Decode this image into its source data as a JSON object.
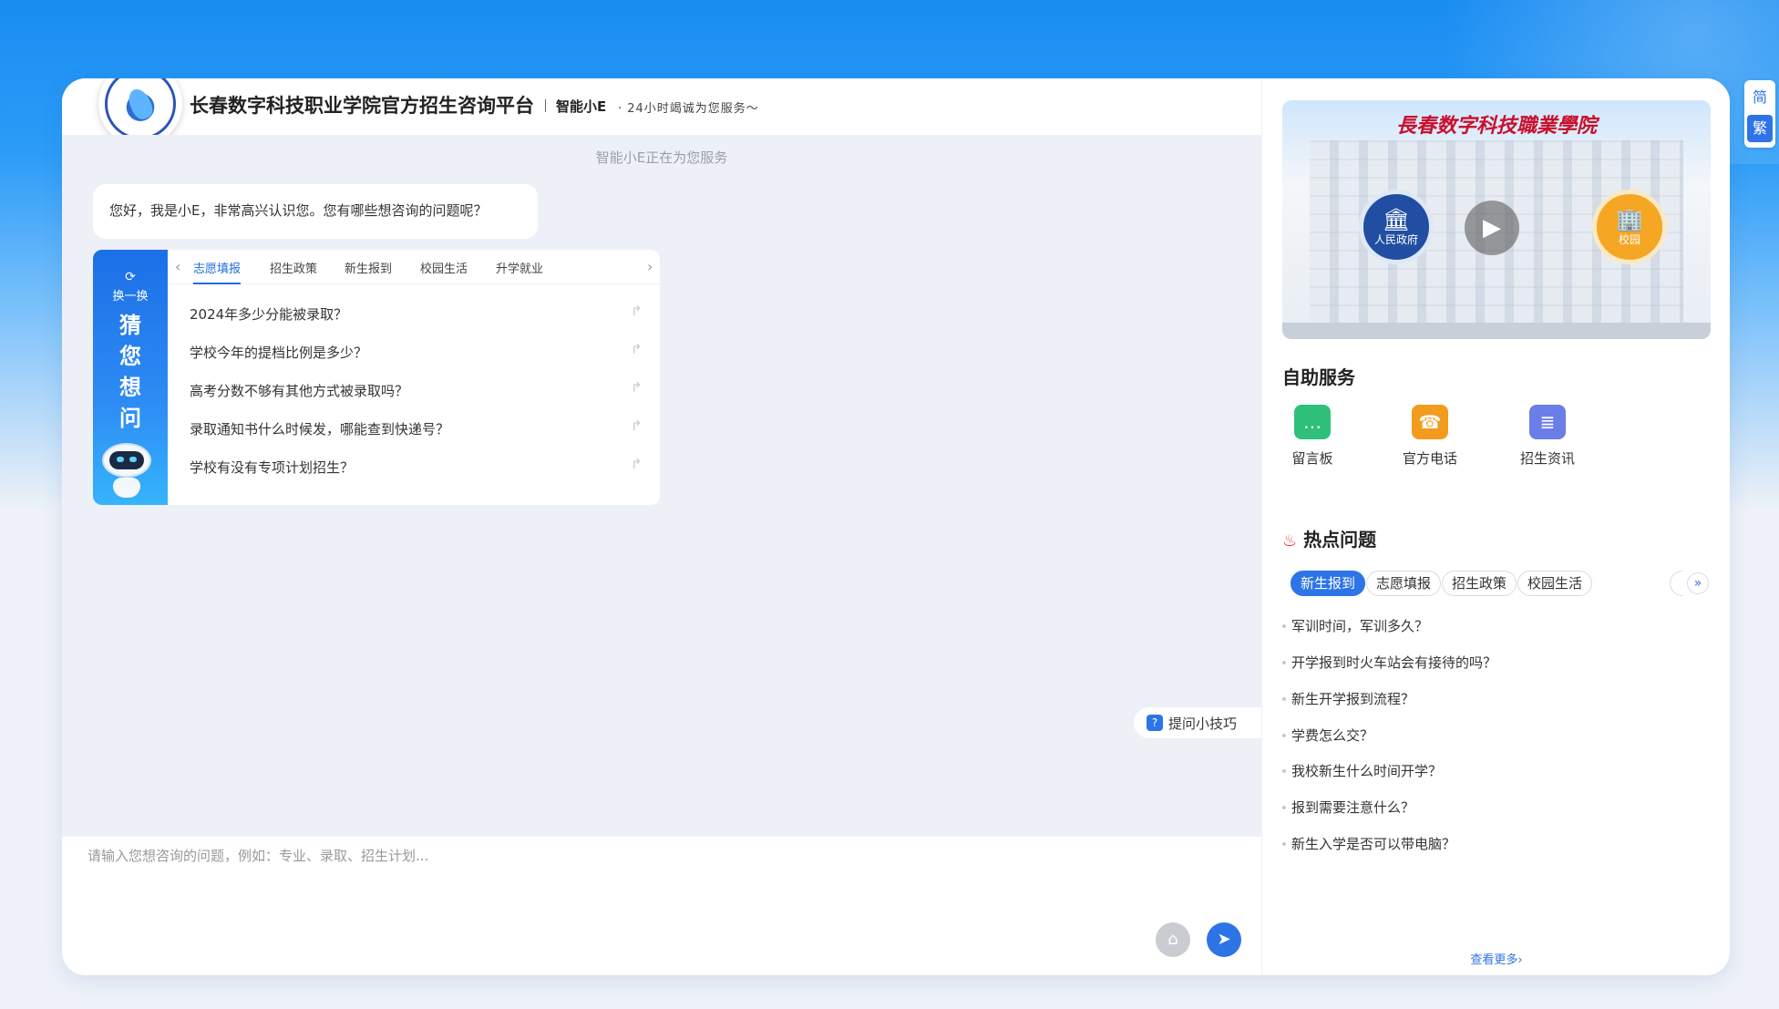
{
  "header": {
    "title": "长春数字科技职业学院官方招生咨询平台",
    "brand": "智能小E",
    "slogan": "· 24小时竭诚为您服务～"
  },
  "chat": {
    "status": "智能小E正在为您服务",
    "greeting": "您好，我是小E，非常高兴认识您。您有哪些想咨询的问题呢？",
    "guess": {
      "refresh_label": "换一换",
      "title": "猜您想问",
      "tabs": [
        "志愿填报",
        "招生政策",
        "新生报到",
        "校园生活",
        "升学就业"
      ],
      "active_tab": "志愿填报",
      "questions": [
        "2024年多少分能被录取？",
        "学校今年的提档比例是多少？",
        "高考分数不够有其他方式被录取吗？",
        "录取通知书什么时候发，哪能查到快递号？",
        "学校有没有专项计划招生？"
      ]
    },
    "tips_label": "提问小技巧",
    "input_placeholder": "请输入您想咨询的问题，例如：专业、录取、招生计划..."
  },
  "sidebar": {
    "banner": {
      "title": "長春数字科技職業學院",
      "gov_label": "人民政府",
      "school_label": "校园"
    },
    "self_service": {
      "title": "自助服务",
      "items": [
        {
          "label": "留言板",
          "icon": "message-board-icon",
          "color": "#2fc07a"
        },
        {
          "label": "官方电话",
          "icon": "phone-icon",
          "color": "#f39b1c"
        },
        {
          "label": "招生资讯",
          "icon": "news-icon",
          "color": "#6b7ee8"
        }
      ]
    },
    "hot": {
      "title": "热点问题",
      "tabs": [
        "新生报到",
        "志愿填报",
        "招生政策",
        "校园生活"
      ],
      "active_tab": "新生报到",
      "questions": [
        "军训时间，军训多久？",
        "开学报到时火车站会有接待的吗？",
        "新生开学报到流程？",
        "学费怎么交？",
        "我校新生什么时间开学？",
        "报到需要注意什么？",
        "新生入学是否可以带电脑？"
      ],
      "more_label": "查看更多"
    }
  },
  "lang": {
    "simplified": "简",
    "traditional": "繁"
  },
  "colors": {
    "accent": "#2d74e6",
    "background": "#edf0f7",
    "banner_title": "#c8102e"
  }
}
